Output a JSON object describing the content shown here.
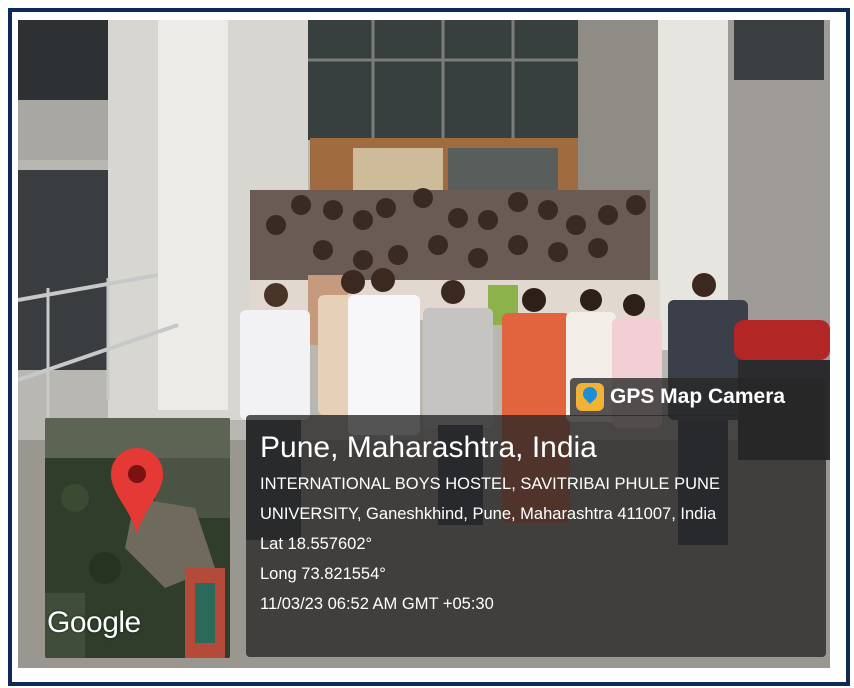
{
  "app": {
    "name": "GPS Map Camera",
    "icon": "map-pin-icon"
  },
  "map": {
    "attribution": "Google",
    "marker_icon": "location-pin-icon",
    "marker_color": "#e53935"
  },
  "location": {
    "title": "Pune, Maharashtra, India",
    "address_line1": "INTERNATIONAL BOYS HOSTEL, SAVITRIBAI PHULE PUNE",
    "address_line2": "UNIVERSITY, Ganeshkhind, Pune, Maharashtra 411007, India",
    "latitude": "Lat 18.557602°",
    "longitude": "Long 73.821554°",
    "timestamp": "11/03/23 06:52 AM GMT +05:30"
  },
  "colors": {
    "frame_border": "#0f2a57",
    "overlay": "#262626",
    "accent": "#f2b233"
  }
}
